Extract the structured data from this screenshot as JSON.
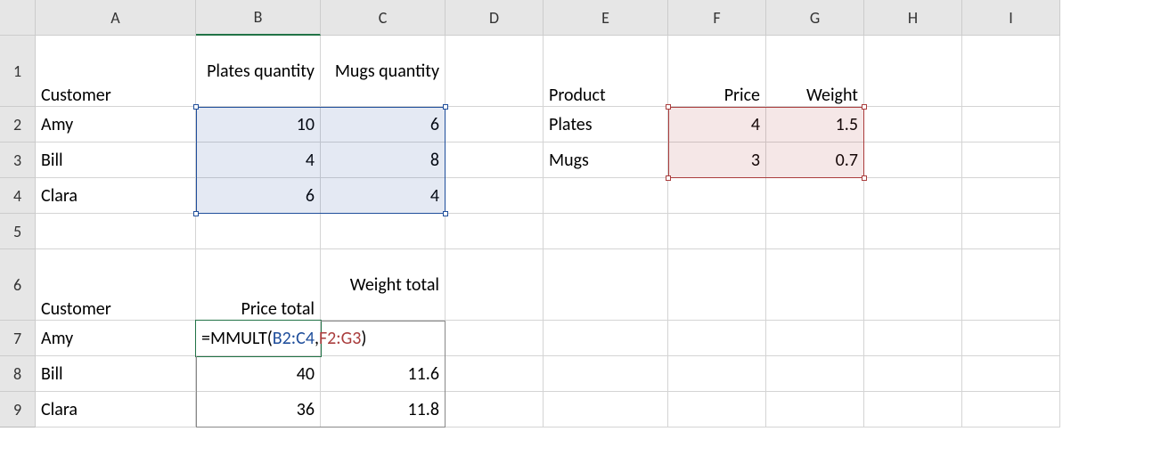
{
  "columns": {
    "A": "A",
    "B": "B",
    "C": "C",
    "D": "D",
    "E": "E",
    "F": "F",
    "G": "G",
    "H": "H",
    "I": "I"
  },
  "rows": {
    "r1": "1",
    "r2": "2",
    "r3": "3",
    "r4": "4",
    "r5": "5",
    "r6": "6",
    "r7": "7",
    "r8": "8",
    "r9": "9"
  },
  "top": {
    "customer_hdr": "Customer",
    "plates_hdr": "Plates quantity",
    "mugs_hdr": "Mugs quantity",
    "customers": [
      "Amy",
      "Bill",
      "Clara"
    ],
    "plates_qty": [
      "10",
      "4",
      "6"
    ],
    "mugs_qty": [
      "6",
      "8",
      "4"
    ]
  },
  "product": {
    "hdr": "Product",
    "price_hdr": "Price",
    "weight_hdr": "Weight",
    "names": [
      "Plates",
      "Mugs"
    ],
    "price": [
      "4",
      "3"
    ],
    "weight": [
      "1.5",
      "0.7"
    ]
  },
  "bottom": {
    "customer_hdr": "Customer",
    "price_total_hdr": "Price total",
    "weight_total_hdr": "Weight total",
    "customers": [
      "Amy",
      "Bill",
      "Clara"
    ],
    "price_total": [
      "",
      "40",
      "36"
    ],
    "weight_total": [
      "",
      "11.6",
      "11.8"
    ]
  },
  "formula": {
    "eq": "=",
    "fn": "MMULT",
    "open": "(",
    "ref1": "B2:C4",
    "comma": ",",
    "ref2": "F2:G3",
    "close": ")"
  }
}
